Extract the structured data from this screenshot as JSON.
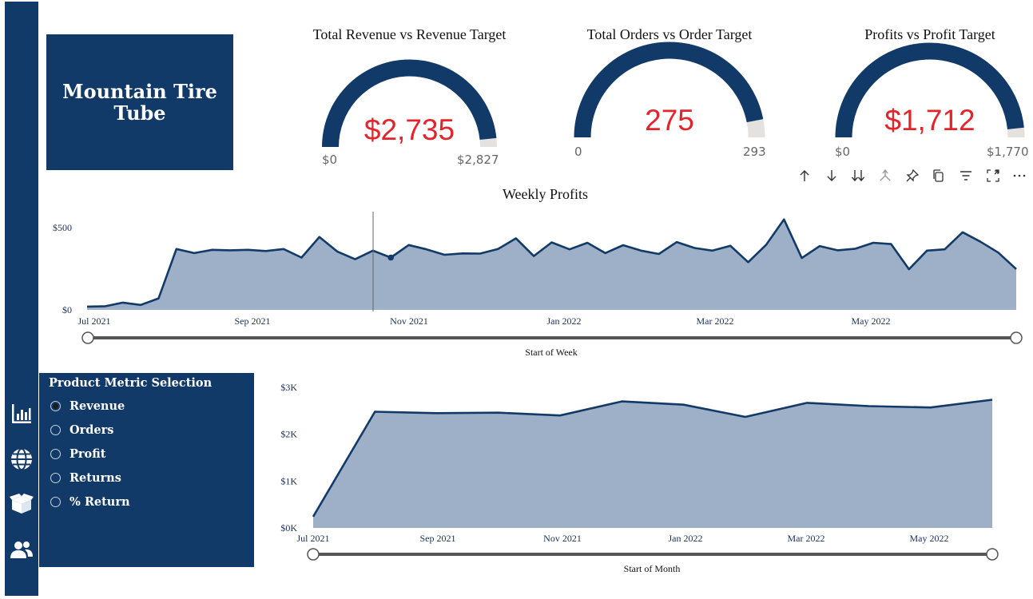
{
  "app": {
    "brand": "Mountain Tire Tube"
  },
  "nav_icons": [
    "bar-chart-icon",
    "globe-icon",
    "box-icon",
    "users-icon"
  ],
  "kpis": [
    {
      "title": "Total Revenue vs Revenue Target",
      "value": "$2,735",
      "min_label": "$0",
      "max_label": "$2,827",
      "fraction": 0.9675
    },
    {
      "title": "Total Orders vs Order Target",
      "value": "275",
      "min_label": "0",
      "max_label": "293",
      "fraction": 0.9386
    },
    {
      "title": "Profits vs Profit Target",
      "value": "$1,712",
      "min_label": "$0",
      "max_label": "$1,770",
      "fraction": 0.9672
    }
  ],
  "toolbar": [
    "arrow-up-icon",
    "arrow-down-icon",
    "double-arrow-down-icon",
    "drill-icon",
    "pin-icon",
    "copy-icon",
    "filter-icon",
    "focus-mode-icon",
    "more-options-icon"
  ],
  "weekly": {
    "title": "Weekly Profits",
    "slider_label": "Start of Week",
    "y_ticks": [
      "$0",
      "$500"
    ],
    "x_ticks": [
      "Jul 2021",
      "Sep 2021",
      "Nov 2021",
      "Jan 2022",
      "Mar 2022",
      "May 2022"
    ]
  },
  "monthly": {
    "slider_label": "Start of Month",
    "y_ticks": [
      "$0K",
      "$1K",
      "$2K",
      "$3K"
    ],
    "x_ticks": [
      "Jul 2021",
      "Sep 2021",
      "Nov 2021",
      "Jan 2022",
      "Mar 2022",
      "May 2022"
    ]
  },
  "metric_selection": {
    "title": "Product Metric Selection",
    "options": [
      "Revenue",
      "Orders",
      "Profit",
      "Returns",
      "% Return"
    ],
    "selected": "Revenue"
  },
  "colors": {
    "navy": "#123a68",
    "area_fill": "#9eb0c7",
    "gauge_rest": "#e4e1de",
    "kpi_red": "#e3242b"
  },
  "chart_data": [
    {
      "type": "area",
      "title": "Weekly Profits",
      "xlabel": "Start of Week",
      "ylabel": "",
      "ylim": [
        0,
        600
      ],
      "x": [
        "2021-07-05",
        "2021-07-12",
        "2021-07-19",
        "2021-07-26",
        "2021-08-02",
        "2021-08-09",
        "2021-08-16",
        "2021-08-23",
        "2021-08-30",
        "2021-09-06",
        "2021-09-13",
        "2021-09-20",
        "2021-09-27",
        "2021-10-04",
        "2021-10-11",
        "2021-10-18",
        "2021-10-25",
        "2021-11-01",
        "2021-11-08",
        "2021-11-15",
        "2021-11-22",
        "2021-11-29",
        "2021-12-06",
        "2021-12-13",
        "2021-12-20",
        "2021-12-27",
        "2022-01-03",
        "2022-01-10",
        "2022-01-17",
        "2022-01-24",
        "2022-01-31",
        "2022-02-07",
        "2022-02-14",
        "2022-02-21",
        "2022-02-28",
        "2022-03-07",
        "2022-03-14",
        "2022-03-21",
        "2022-03-28",
        "2022-04-04",
        "2022-04-11",
        "2022-04-18",
        "2022-04-25",
        "2022-05-02",
        "2022-05-09",
        "2022-05-16",
        "2022-05-23",
        "2022-05-30",
        "2022-06-06",
        "2022-06-13",
        "2022-06-20",
        "2022-06-27"
      ],
      "series": [
        {
          "values": [
            20,
            22,
            44,
            30,
            70,
            370,
            345,
            365,
            362,
            365,
            358,
            370,
            318,
            443,
            355,
            308,
            360,
            318,
            394,
            368,
            335,
            343,
            342,
            370,
            435,
            327,
            410,
            368,
            408,
            345,
            393,
            360,
            340,
            412,
            376,
            360,
            390,
            290,
            395,
            550,
            315,
            388,
            362,
            372,
            408,
            400,
            247,
            360,
            368,
            472,
            414,
            348,
            248
          ]
        }
      ]
    },
    {
      "type": "area",
      "title": "",
      "xlabel": "Start of Month",
      "ylabel": "",
      "ylim": [
        0,
        3000
      ],
      "x": [
        "2021-07",
        "2021-08",
        "2021-09",
        "2021-10",
        "2021-11",
        "2021-12",
        "2022-01",
        "2022-02",
        "2022-03",
        "2022-04",
        "2022-05",
        "2022-06"
      ],
      "series": [
        {
          "values": [
            240,
            2480,
            2450,
            2460,
            2400,
            2700,
            2630,
            2370,
            2670,
            2600,
            2570,
            2735
          ]
        }
      ]
    }
  ]
}
